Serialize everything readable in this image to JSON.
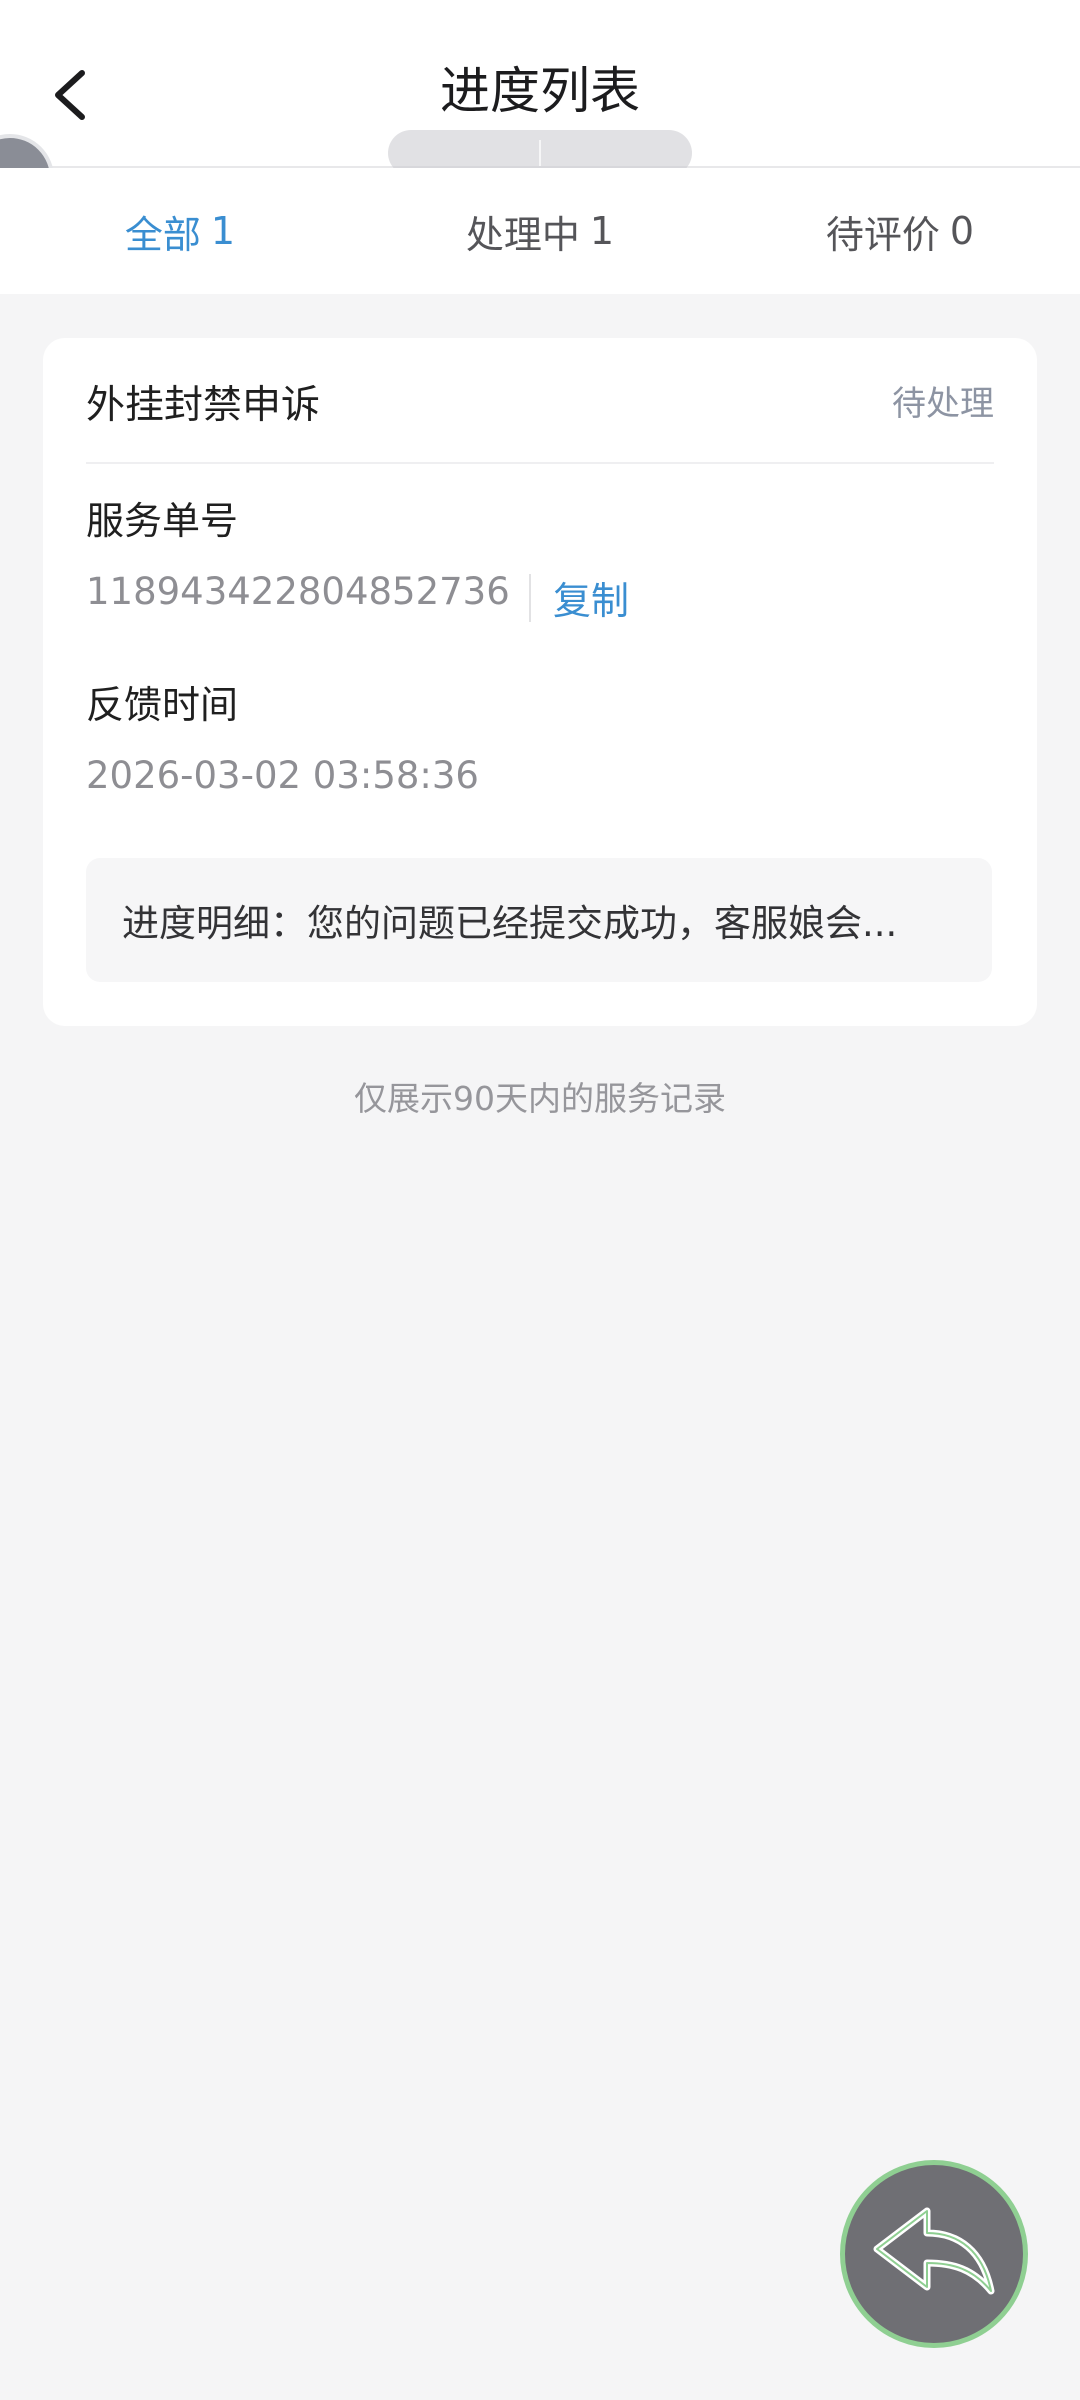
{
  "header": {
    "title": "进度列表",
    "back_icon": "chevron-left-icon",
    "overlay_left": "",
    "overlay_right": ""
  },
  "tabs": [
    {
      "label": "全部",
      "count": "1",
      "active": true
    },
    {
      "label": "处理中",
      "count": "1",
      "active": false
    },
    {
      "label": "待评价",
      "count": "0",
      "active": false
    }
  ],
  "card": {
    "title": "外挂封禁申诉",
    "status": "待处理",
    "service_no_label": "服务单号",
    "service_no": "118943422804852736",
    "copy_label": "复制",
    "feedback_time_label": "反馈时间",
    "feedback_time": "2026-03-02 03:58:36",
    "progress_detail": "进度明细：您的问题已经提交成功，客服娘会..."
  },
  "footer_note": "仅展示90天内的服务记录",
  "fab": {
    "icon": "reply-arrow-icon"
  },
  "colors": {
    "accent": "#3a8ed1",
    "status_gray": "#8d94a3",
    "fab_ring": "#8fcf92"
  }
}
